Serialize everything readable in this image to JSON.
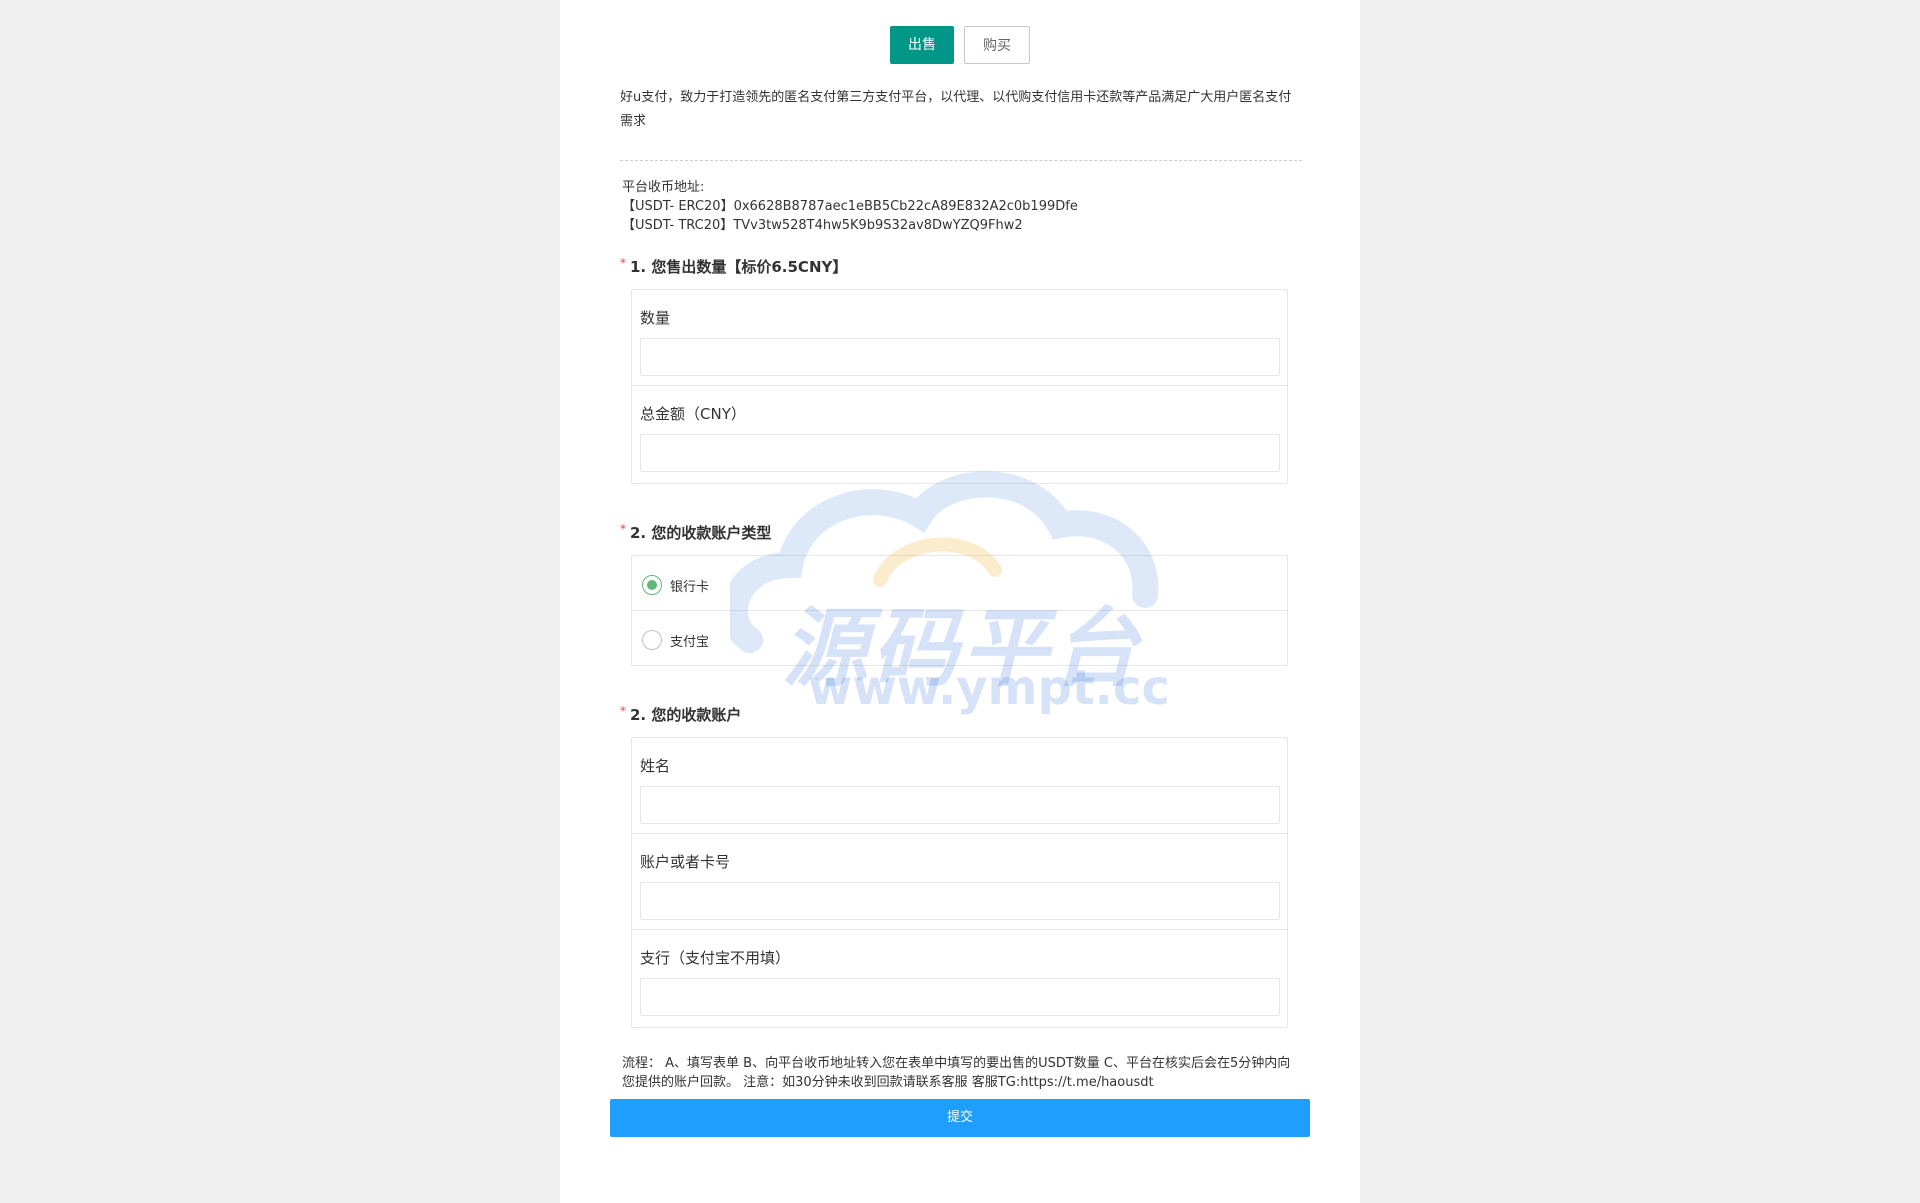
{
  "tabs": {
    "sell": "出售",
    "buy": "购买"
  },
  "intro": "好u支付，致力于打造领先的匿名支付第三方支付平台，以代理、以代购支付信用卡还款等产品满足广大用户匿名支付需求",
  "platform_address": {
    "label": "平台收币地址:",
    "erc20": "【USDT- ERC20】0x6628B8787aec1eBB5Cb22cA89E832A2c0b199Dfe",
    "trc20": "【USDT- TRC20】TVv3tw528T4hw5K9b9S32av8DwYZQ9Fhw2"
  },
  "section1": {
    "required_mark": "*",
    "title": "1. 您售出数量【标价6.5CNY】",
    "fields": [
      {
        "label": "数量",
        "value": ""
      },
      {
        "label": "总金额（CNY）",
        "value": ""
      }
    ]
  },
  "section2": {
    "required_mark": "*",
    "title": "2. 您的收款账户类型",
    "options": [
      {
        "label": "银行卡",
        "checked": true
      },
      {
        "label": "支付宝",
        "checked": false
      }
    ]
  },
  "section3": {
    "required_mark": "*",
    "title": "2. 您的收款账户",
    "fields": [
      {
        "label": "姓名",
        "value": ""
      },
      {
        "label": "账户或者卡号",
        "value": ""
      },
      {
        "label": "支行（支付宝不用填）",
        "value": ""
      }
    ]
  },
  "flow": "流程： A、填写表单 B、向平台收币地址转入您在表单中填写的要出售的USDT数量 C、平台在核实后会在5分钟内向您提供的账户回款。 注意：如30分钟未收到回款请联系客服 客服TG:https://t.me/haousdt",
  "submit_label": "提交",
  "watermark": {
    "text": "源码平台",
    "url": "www.ympt.cc"
  },
  "colors": {
    "primary": "#009688",
    "submit": "#1e9fff",
    "radio": "#5fb878",
    "required": "#e04848"
  }
}
